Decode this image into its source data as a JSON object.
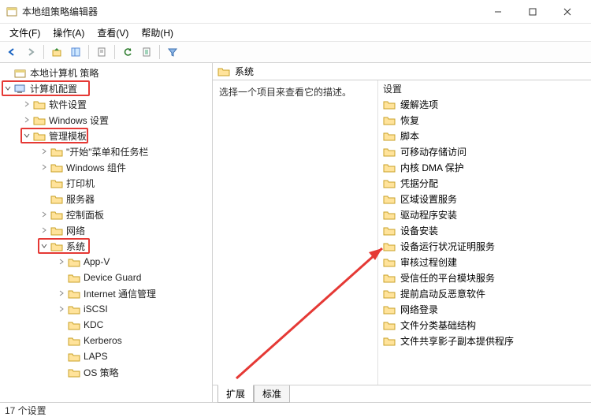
{
  "window": {
    "title": "本地组策略编辑器"
  },
  "menu": {
    "file": "文件(F)",
    "action": "操作(A)",
    "view": "查看(V)",
    "help": "帮助(H)"
  },
  "tree": {
    "root": "本地计算机 策略",
    "computer_config": "计算机配置",
    "software": "软件设置",
    "windows_settings": "Windows 设置",
    "admin_templates": "管理模板",
    "start_taskbar": "\"开始\"菜单和任务栏",
    "win_components": "Windows 组件",
    "printers": "打印机",
    "servers": "服务器",
    "control_panel": "控制面板",
    "network": "网络",
    "system": "系统",
    "appv": "App-V",
    "device_guard": "Device Guard",
    "internet_comm": "Internet 通信管理",
    "iscsi": "iSCSI",
    "kdc": "KDC",
    "kerberos": "Kerberos",
    "laps": "LAPS",
    "os_policy": "OS 策略"
  },
  "right": {
    "header": "系统",
    "desc": "选择一个项目来查看它的描述。",
    "col_setting": "设置",
    "items": [
      "缓解选项",
      "恢复",
      "脚本",
      "可移动存储访问",
      "内核 DMA 保护",
      "凭据分配",
      "区域设置服务",
      "驱动程序安装",
      "设备安装",
      "设备运行状况证明服务",
      "审核过程创建",
      "受信任的平台模块服务",
      "提前启动反恶意软件",
      "网络登录",
      "文件分类基础结构",
      "文件共享影子副本提供程序"
    ]
  },
  "tabs": {
    "extended": "扩展",
    "standard": "标准"
  },
  "status": "17 个设置"
}
